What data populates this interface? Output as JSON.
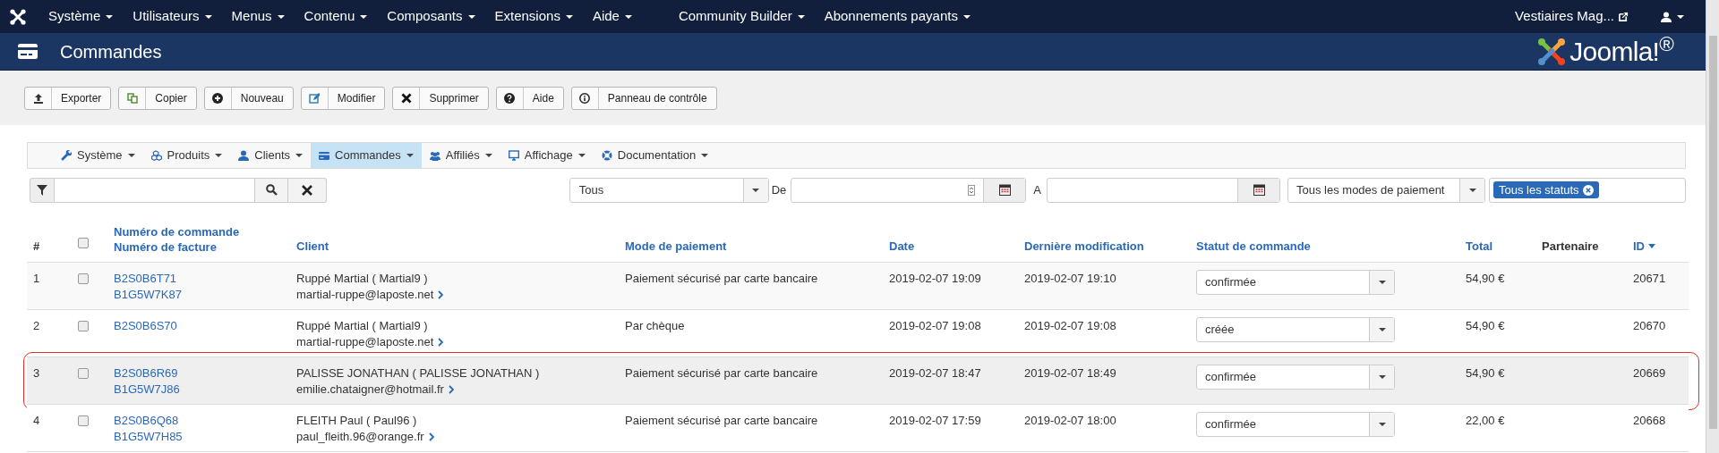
{
  "top_menu": {
    "items": [
      {
        "label": "Système"
      },
      {
        "label": "Utilisateurs"
      },
      {
        "label": "Menus"
      },
      {
        "label": "Contenu"
      },
      {
        "label": "Composants"
      },
      {
        "label": "Extensions"
      },
      {
        "label": "Aide"
      },
      {
        "label": "Community Builder"
      },
      {
        "label": "Abonnements payants"
      }
    ],
    "site_link": "Vestiaires Mag..."
  },
  "page_title": "Commandes",
  "logo_text": "Joomla!$^{®}$",
  "toolbar": [
    {
      "label": "Exporter"
    },
    {
      "label": "Copier"
    },
    {
      "label": "Nouveau"
    },
    {
      "label": "Modifier"
    },
    {
      "label": "Supprimer"
    },
    {
      "label": "Aide"
    },
    {
      "label": "Panneau de contrôle"
    }
  ],
  "submenu": [
    {
      "label": "Système",
      "selected": false
    },
    {
      "label": "Produits",
      "selected": false
    },
    {
      "label": "Clients",
      "selected": false
    },
    {
      "label": "Commandes",
      "selected": true
    },
    {
      "label": "Affiliés",
      "selected": false
    },
    {
      "label": "Affichage",
      "selected": false
    },
    {
      "label": "Documentation",
      "selected": false
    }
  ],
  "filters": {
    "date_select": "Tous",
    "from_label": "De",
    "to_label": "A",
    "payment_select": "Tous les modes de paiement",
    "status_tag": "Tous les statuts"
  },
  "table": {
    "columns": [
      {
        "kind": "text",
        "label": "#"
      },
      {
        "kind": "checkbox",
        "checked": false
      },
      {
        "kind": "link",
        "label": "Numéro de commande",
        "label_2": "Numéro de facture"
      },
      {
        "kind": "link",
        "label": "Client"
      },
      {
        "kind": "link",
        "label": "Mode de paiement"
      },
      {
        "kind": "link",
        "label": "Date"
      },
      {
        "kind": "link",
        "label": "Dernière modification"
      },
      {
        "kind": "link",
        "label": "Statut de commande"
      },
      {
        "kind": "link",
        "label": "Total"
      },
      {
        "kind": "text",
        "label": "Partenaire"
      },
      {
        "kind": "sorted",
        "label": "ID"
      }
    ],
    "rows": [
      {
        "index": "1",
        "checked": false,
        "highlighted": false,
        "order_number": "B2S0B6T71",
        "invoice_number": "B1G5W7K87",
        "client": "Ruppé Martial ( Martial9 )",
        "email": "martial-ruppe@laposte.net",
        "payment": "Paiement sécurisé par carte bancaire",
        "date": "2019-02-07 19:09",
        "modified": "2019-02-07 19:10",
        "status": "confirmée",
        "total": "54,90 €",
        "id": "20671"
      },
      {
        "index": "2",
        "checked": false,
        "highlighted": false,
        "order_number": "B2S0B6S70",
        "client": "Ruppé Martial ( Martial9 )",
        "email": "martial-ruppe@laposte.net",
        "payment": "Par chèque",
        "date": "2019-02-07 19:08",
        "modified": "2019-02-07 19:08",
        "status": "créée",
        "total": "54,90 €",
        "id": "20670"
      },
      {
        "index": "3",
        "checked": false,
        "highlighted": true,
        "order_number": "B2S0B6R69",
        "invoice_number": "B1G5W7J86",
        "client": "PALISSE JONATHAN ( PALISSE JONATHAN )",
        "email": "emilie.chataigner@hotmail.fr",
        "payment": "Paiement sécurisé par carte bancaire",
        "date": "2019-02-07 18:47",
        "modified": "2019-02-07 18:49",
        "status": "confirmée",
        "total": "54,90 €",
        "id": "20669"
      },
      {
        "index": "4",
        "checked": false,
        "highlighted": false,
        "order_number": "B2S0B6Q68",
        "invoice_number": "B1G5W7H85",
        "client": "FLEITH Paul ( Paul96 )",
        "email": "paul_fleith.96@orange.fr",
        "payment": "Paiement sécurisé par carte bancaire",
        "date": "2019-02-07 17:59",
        "modified": "2019-02-07 18:00",
        "status": "confirmée",
        "total": "22,00 €",
        "id": "20668"
      }
    ]
  }
}
